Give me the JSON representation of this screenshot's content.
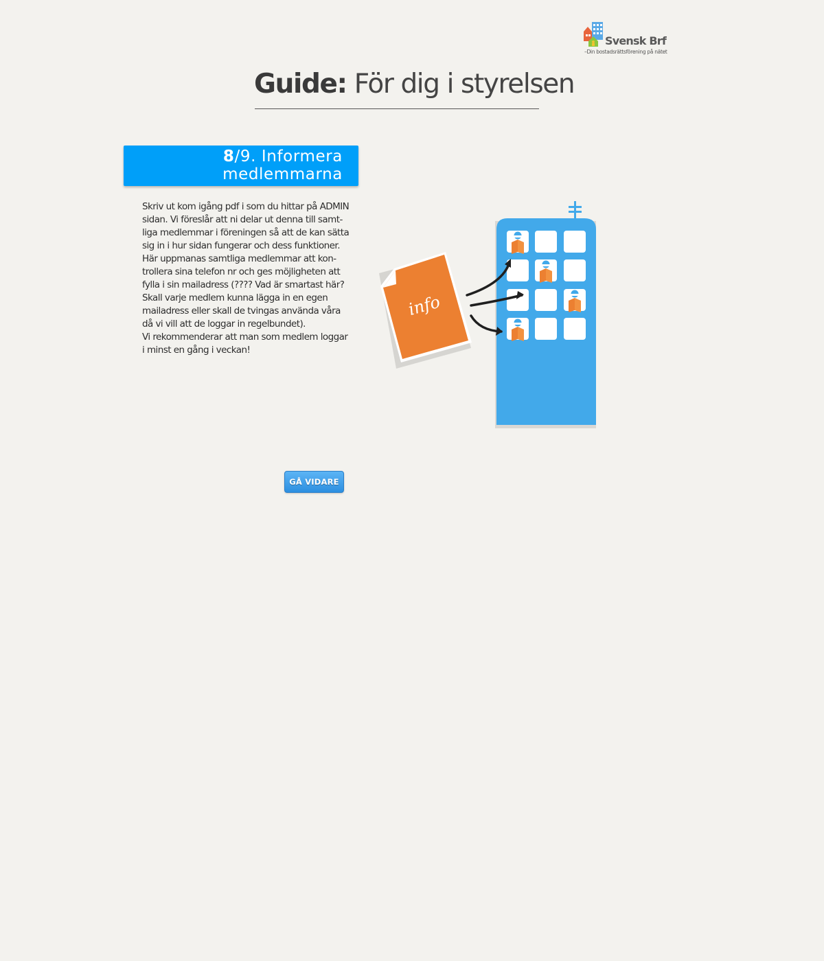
{
  "logo": {
    "name": "Svensk Brf",
    "tagline": "–Din bostadsrättsförening på nätet"
  },
  "header": {
    "title_bold": "Guide:",
    "title_rest": "För dig i styrelsen"
  },
  "step": {
    "current": "8",
    "suffix": "/9. Informera",
    "title_line2": "medlemmarna"
  },
  "content": {
    "lines": [
      "Skriv ut kom igång pdf i som du hittar på ADMIN",
      "sidan. Vi föreslår att ni delar ut denna till samt-",
      "liga medlemmar i föreningen så att de kan sätta",
      "sig in i hur sidan fungerar och dess funktioner.",
      "Här uppmanas samtliga medlemmar att kon-",
      "trollera sina telefon nr och ges möjligheten att",
      "fylla i sin mailadress (????  Vad är smartast här?",
      "Skall varje medlem kunna lägga in en egen",
      "mailadress eller skall de tvingas använda våra",
      "då vi vill att de loggar in regelbundet).",
      "Vi rekommenderar att man som medlem loggar",
      "i minst en gång i veckan!"
    ]
  },
  "illustration": {
    "document_label": "info",
    "colors": {
      "building": "#42a9ea",
      "document": "#ec8031",
      "person_head": "#42a9ea",
      "book": "#ec8031"
    }
  },
  "actions": {
    "next_label": "GÅ VIDARE"
  },
  "colors": {
    "background": "#f3f2ee",
    "banner": "#009ff9",
    "button": "#3a9be6"
  }
}
